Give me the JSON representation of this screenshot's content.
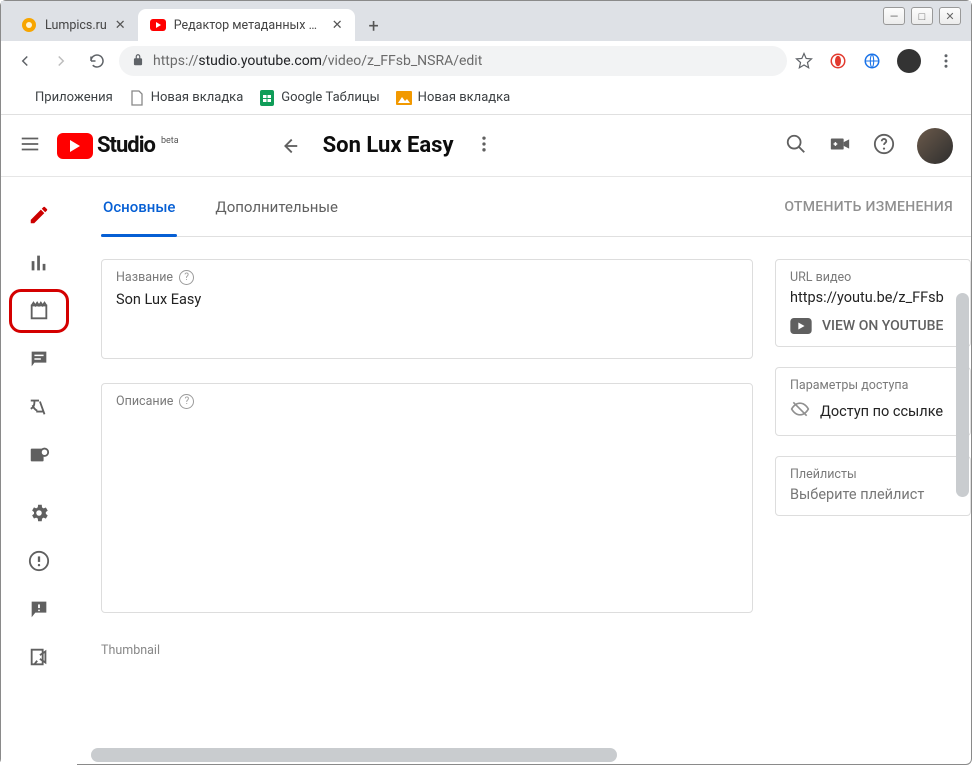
{
  "browser": {
    "tabs": [
      {
        "title": "Lumpics.ru",
        "active": false
      },
      {
        "title": "Редактор метаданных видео – Y",
        "active": true
      }
    ],
    "url_prefix": "https://",
    "url_host": "studio.youtube.com",
    "url_path": "/video/z_FFsb_NSRA/edit"
  },
  "bookmarks": {
    "apps": "Приложения",
    "items": [
      "Новая вкладка",
      "Google Таблицы",
      "Новая вкладка"
    ]
  },
  "studio_header": {
    "logo_word": "Studio",
    "logo_badge": "beta",
    "title": "Son Lux Easy"
  },
  "meta_tabs": {
    "basic": "Основные",
    "advanced": "Дополнительные",
    "revert": "ОТМЕНИТЬ ИЗМЕНЕНИЯ"
  },
  "fields": {
    "title_label": "Название",
    "title_value": "Son Lux   Easy",
    "description_label": "Описание"
  },
  "side": {
    "url_label": "URL видео",
    "url_value": "https://youtu.be/z_FFsb",
    "view_on_youtube": "VIEW ON YOUTUBE",
    "access_label": "Параметры доступа",
    "access_value": "Доступ по ссылке",
    "playlists_label": "Плейлисты",
    "playlists_placeholder": "Выберите плейлист"
  },
  "thumbnail_label": "Thumbnail"
}
